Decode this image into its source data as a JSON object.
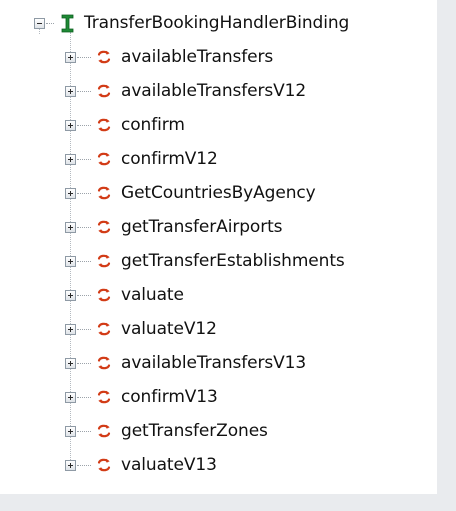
{
  "tree": {
    "root": {
      "label": "TransferBookingHandlerBinding",
      "icon": "binding-icon",
      "expanded": true
    },
    "children": [
      {
        "label": "availableTransfers",
        "icon": "operation-icon",
        "expanded": false
      },
      {
        "label": "availableTransfersV12",
        "icon": "operation-icon",
        "expanded": false
      },
      {
        "label": "confirm",
        "icon": "operation-icon",
        "expanded": false
      },
      {
        "label": "confirmV12",
        "icon": "operation-icon",
        "expanded": false
      },
      {
        "label": "GetCountriesByAgency",
        "icon": "operation-icon",
        "expanded": false
      },
      {
        "label": "getTransferAirports",
        "icon": "operation-icon",
        "expanded": false
      },
      {
        "label": "getTransferEstablishments",
        "icon": "operation-icon",
        "expanded": false
      },
      {
        "label": "valuate",
        "icon": "operation-icon",
        "expanded": false
      },
      {
        "label": "valuateV12",
        "icon": "operation-icon",
        "expanded": false
      },
      {
        "label": "availableTransfersV13",
        "icon": "operation-icon",
        "expanded": false
      },
      {
        "label": "confirmV13",
        "icon": "operation-icon",
        "expanded": false
      },
      {
        "label": "getTransferZones",
        "icon": "operation-icon",
        "expanded": false
      },
      {
        "label": "valuateV13",
        "icon": "operation-icon",
        "expanded": false
      }
    ]
  },
  "colors": {
    "binding_icon": "#1f8a35",
    "operation_icon": "#d23b16",
    "text": "#111111",
    "panel_background": "#ffffff",
    "outer_background": "#e9ebee"
  }
}
